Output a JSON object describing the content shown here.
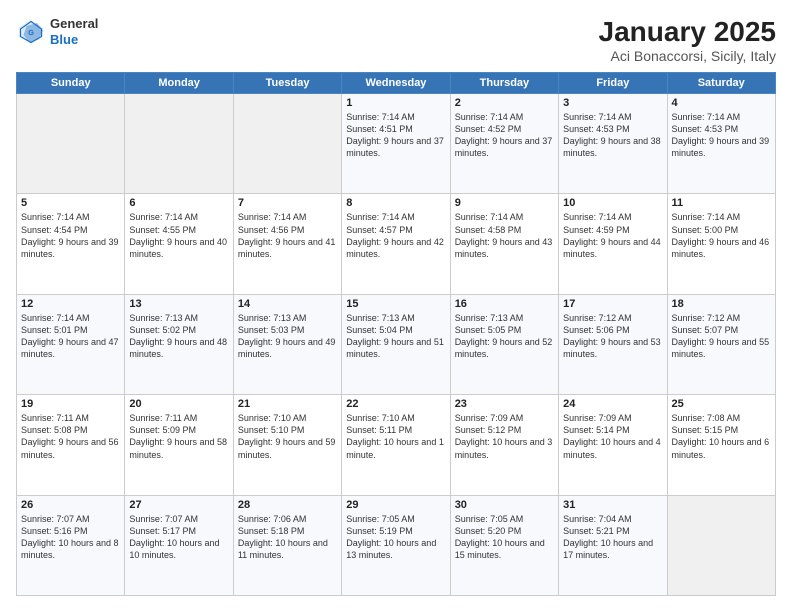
{
  "header": {
    "logo_general": "General",
    "logo_blue": "Blue",
    "month": "January 2025",
    "location": "Aci Bonaccorsi, Sicily, Italy"
  },
  "weekdays": [
    "Sunday",
    "Monday",
    "Tuesday",
    "Wednesday",
    "Thursday",
    "Friday",
    "Saturday"
  ],
  "weeks": [
    [
      {
        "day": "",
        "text": ""
      },
      {
        "day": "",
        "text": ""
      },
      {
        "day": "",
        "text": ""
      },
      {
        "day": "1",
        "text": "Sunrise: 7:14 AM\nSunset: 4:51 PM\nDaylight: 9 hours and 37 minutes."
      },
      {
        "day": "2",
        "text": "Sunrise: 7:14 AM\nSunset: 4:52 PM\nDaylight: 9 hours and 37 minutes."
      },
      {
        "day": "3",
        "text": "Sunrise: 7:14 AM\nSunset: 4:53 PM\nDaylight: 9 hours and 38 minutes."
      },
      {
        "day": "4",
        "text": "Sunrise: 7:14 AM\nSunset: 4:53 PM\nDaylight: 9 hours and 39 minutes."
      }
    ],
    [
      {
        "day": "5",
        "text": "Sunrise: 7:14 AM\nSunset: 4:54 PM\nDaylight: 9 hours and 39 minutes."
      },
      {
        "day": "6",
        "text": "Sunrise: 7:14 AM\nSunset: 4:55 PM\nDaylight: 9 hours and 40 minutes."
      },
      {
        "day": "7",
        "text": "Sunrise: 7:14 AM\nSunset: 4:56 PM\nDaylight: 9 hours and 41 minutes."
      },
      {
        "day": "8",
        "text": "Sunrise: 7:14 AM\nSunset: 4:57 PM\nDaylight: 9 hours and 42 minutes."
      },
      {
        "day": "9",
        "text": "Sunrise: 7:14 AM\nSunset: 4:58 PM\nDaylight: 9 hours and 43 minutes."
      },
      {
        "day": "10",
        "text": "Sunrise: 7:14 AM\nSunset: 4:59 PM\nDaylight: 9 hours and 44 minutes."
      },
      {
        "day": "11",
        "text": "Sunrise: 7:14 AM\nSunset: 5:00 PM\nDaylight: 9 hours and 46 minutes."
      }
    ],
    [
      {
        "day": "12",
        "text": "Sunrise: 7:14 AM\nSunset: 5:01 PM\nDaylight: 9 hours and 47 minutes."
      },
      {
        "day": "13",
        "text": "Sunrise: 7:13 AM\nSunset: 5:02 PM\nDaylight: 9 hours and 48 minutes."
      },
      {
        "day": "14",
        "text": "Sunrise: 7:13 AM\nSunset: 5:03 PM\nDaylight: 9 hours and 49 minutes."
      },
      {
        "day": "15",
        "text": "Sunrise: 7:13 AM\nSunset: 5:04 PM\nDaylight: 9 hours and 51 minutes."
      },
      {
        "day": "16",
        "text": "Sunrise: 7:13 AM\nSunset: 5:05 PM\nDaylight: 9 hours and 52 minutes."
      },
      {
        "day": "17",
        "text": "Sunrise: 7:12 AM\nSunset: 5:06 PM\nDaylight: 9 hours and 53 minutes."
      },
      {
        "day": "18",
        "text": "Sunrise: 7:12 AM\nSunset: 5:07 PM\nDaylight: 9 hours and 55 minutes."
      }
    ],
    [
      {
        "day": "19",
        "text": "Sunrise: 7:11 AM\nSunset: 5:08 PM\nDaylight: 9 hours and 56 minutes."
      },
      {
        "day": "20",
        "text": "Sunrise: 7:11 AM\nSunset: 5:09 PM\nDaylight: 9 hours and 58 minutes."
      },
      {
        "day": "21",
        "text": "Sunrise: 7:10 AM\nSunset: 5:10 PM\nDaylight: 9 hours and 59 minutes."
      },
      {
        "day": "22",
        "text": "Sunrise: 7:10 AM\nSunset: 5:11 PM\nDaylight: 10 hours and 1 minute."
      },
      {
        "day": "23",
        "text": "Sunrise: 7:09 AM\nSunset: 5:12 PM\nDaylight: 10 hours and 3 minutes."
      },
      {
        "day": "24",
        "text": "Sunrise: 7:09 AM\nSunset: 5:14 PM\nDaylight: 10 hours and 4 minutes."
      },
      {
        "day": "25",
        "text": "Sunrise: 7:08 AM\nSunset: 5:15 PM\nDaylight: 10 hours and 6 minutes."
      }
    ],
    [
      {
        "day": "26",
        "text": "Sunrise: 7:07 AM\nSunset: 5:16 PM\nDaylight: 10 hours and 8 minutes."
      },
      {
        "day": "27",
        "text": "Sunrise: 7:07 AM\nSunset: 5:17 PM\nDaylight: 10 hours and 10 minutes."
      },
      {
        "day": "28",
        "text": "Sunrise: 7:06 AM\nSunset: 5:18 PM\nDaylight: 10 hours and 11 minutes."
      },
      {
        "day": "29",
        "text": "Sunrise: 7:05 AM\nSunset: 5:19 PM\nDaylight: 10 hours and 13 minutes."
      },
      {
        "day": "30",
        "text": "Sunrise: 7:05 AM\nSunset: 5:20 PM\nDaylight: 10 hours and 15 minutes."
      },
      {
        "day": "31",
        "text": "Sunrise: 7:04 AM\nSunset: 5:21 PM\nDaylight: 10 hours and 17 minutes."
      },
      {
        "day": "",
        "text": ""
      }
    ]
  ]
}
